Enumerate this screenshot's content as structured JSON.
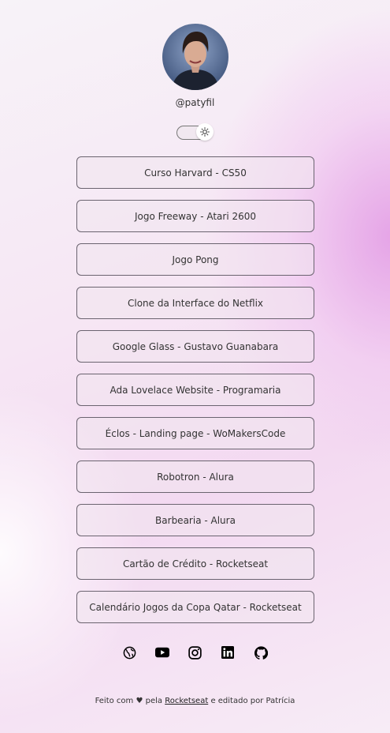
{
  "profile": {
    "handle": "@patyfil"
  },
  "theme_toggle": {
    "icon": "sun-icon"
  },
  "links": [
    "Curso Harvard - CS50",
    "Jogo Freeway - Atari 2600",
    "Jogo Pong",
    "Clone da Interface do Netflix",
    "Google Glass - Gustavo Guanabara",
    "Ada Lovelace Website - Programaria",
    "Éclos - Landing page - WoMakersCode",
    "Robotron - Alura",
    "Barbearia - Alura",
    "Cartão de Crédito - Rocketseat",
    "Calendário Jogos da Copa Qatar - Rocketseat"
  ],
  "socials": [
    "globe-icon",
    "youtube-icon",
    "instagram-icon",
    "linkedin-icon",
    "github-icon"
  ],
  "footer": {
    "prefix": "Feito com ♥ pela",
    "link": "Rocketseat",
    "suffix": "e editado por Patrícia"
  }
}
